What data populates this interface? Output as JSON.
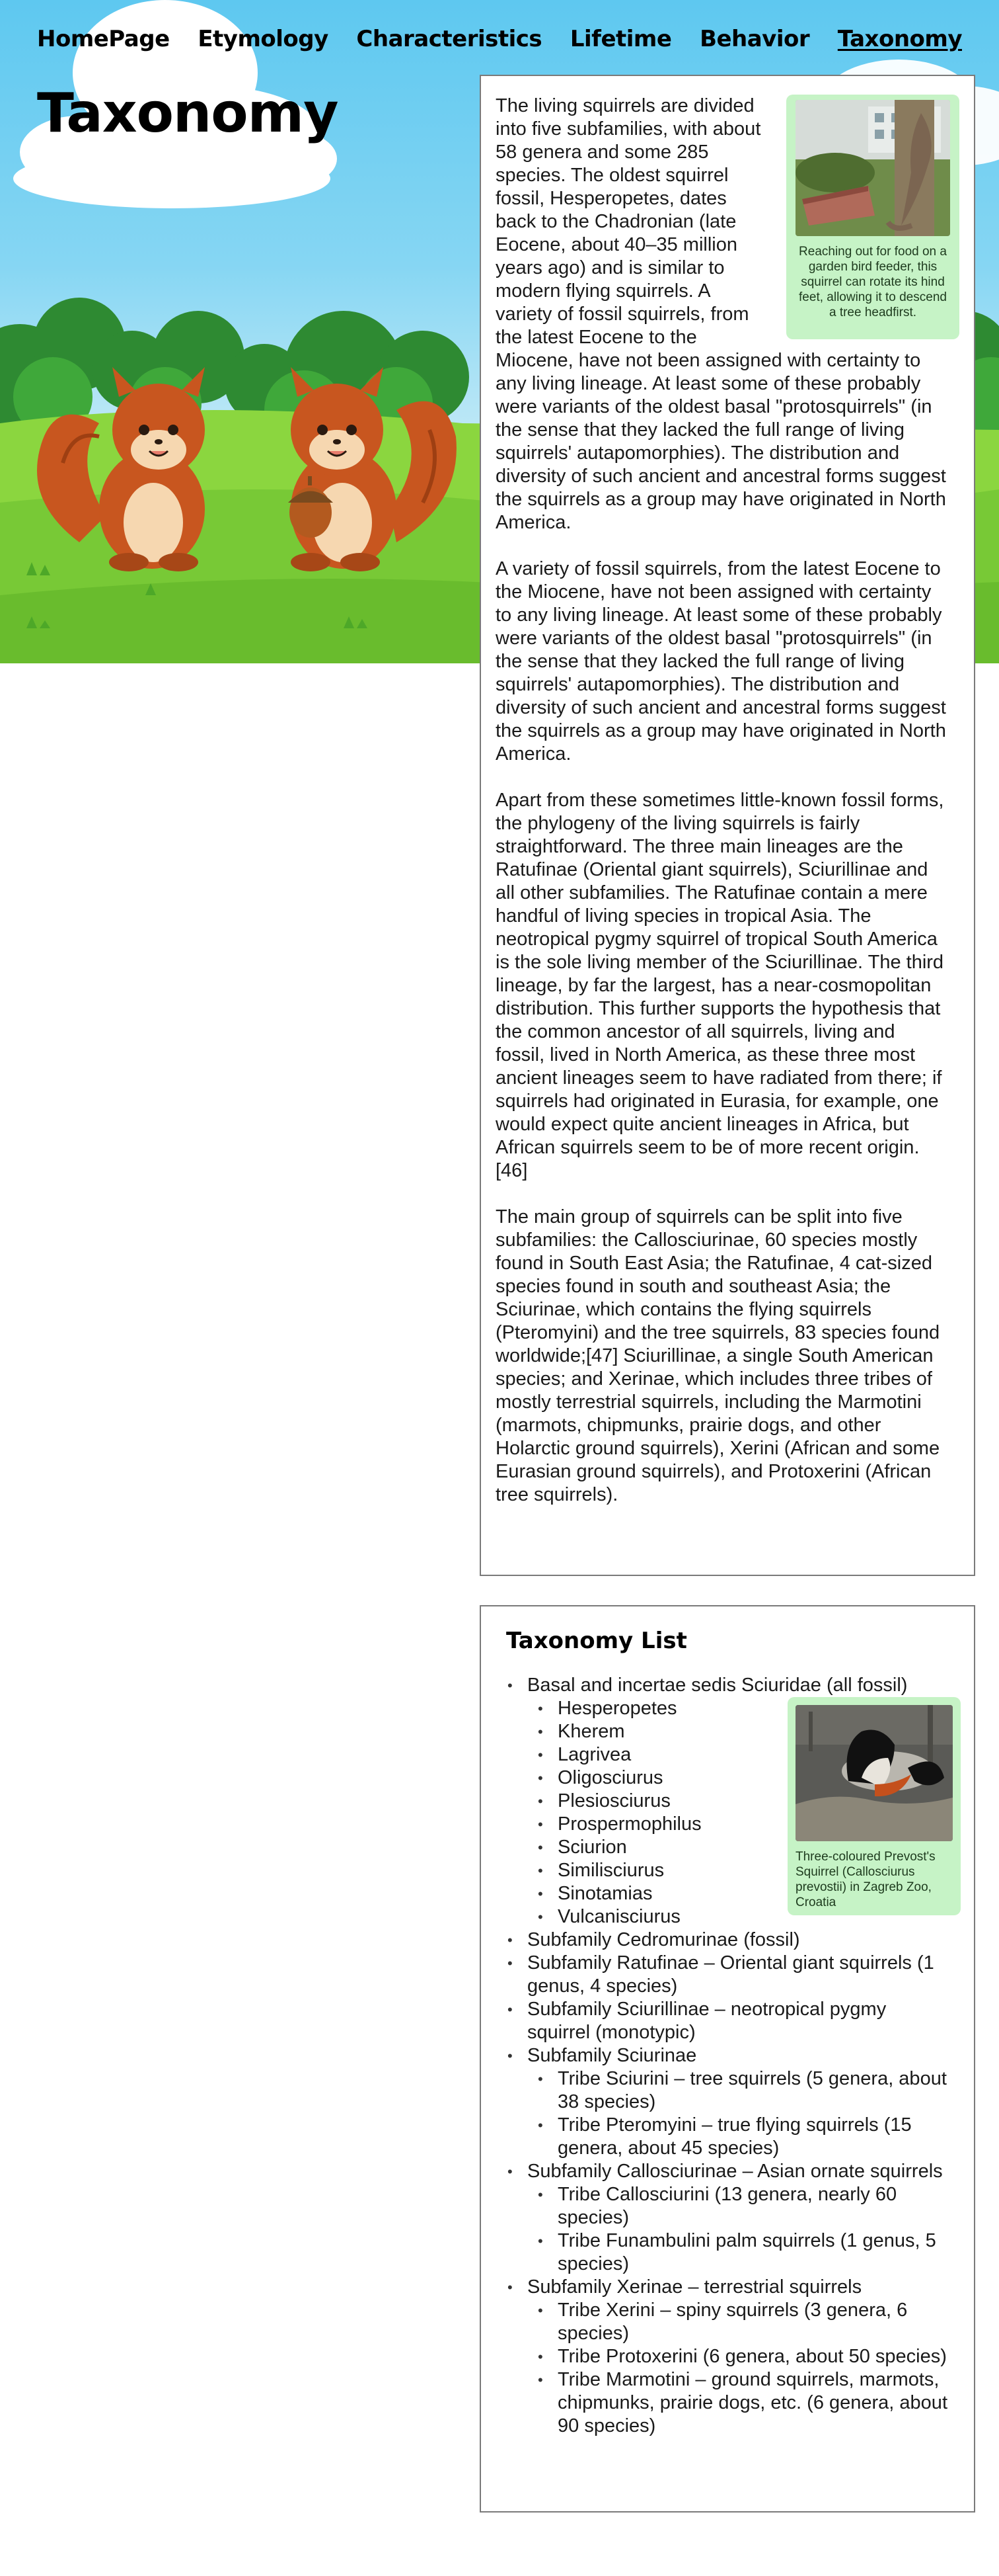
{
  "nav": {
    "items": [
      {
        "label": "HomePage",
        "active": false
      },
      {
        "label": "Etymology",
        "active": false
      },
      {
        "label": "Characteristics",
        "active": false
      },
      {
        "label": "Lifetime",
        "active": false
      },
      {
        "label": "Behavior",
        "active": false
      },
      {
        "label": "Taxonomy",
        "active": true
      }
    ]
  },
  "page": {
    "title": "Taxonomy"
  },
  "article": {
    "figure": {
      "caption": "Reaching out for food on a garden bird feeder, this squirrel can rotate its hind feet, allowing it to descend a tree headfirst.",
      "icon": "squirrel-photo"
    },
    "paragraphs": [
      "The living squirrels are divided into five subfamilies, with about 58 genera and some 285 species. The oldest squirrel fossil, Hesperopetes, dates back to the Chadronian (late Eocene, about 40–35 million years ago) and is similar to modern flying squirrels. A variety of fossil squirrels, from the latest Eocene to the Miocene, have not been assigned with certainty to any living lineage. At least some of these probably were variants of the oldest basal \"protosquirrels\" (in the sense that they lacked the full range of living squirrels' autapomorphies). The distribution and diversity of such ancient and ancestral forms suggest the squirrels as a group may have originated in North America.",
      "A variety of fossil squirrels, from the latest Eocene to the Miocene, have not been assigned with certainty to any living lineage. At least some of these probably were variants of the oldest basal \"protosquirrels\" (in the sense that they lacked the full range of living squirrels' autapomorphies). The distribution and diversity of such ancient and ancestral forms suggest the squirrels as a group may have originated in North America.",
      "Apart from these sometimes little-known fossil forms, the phylogeny of the living squirrels is fairly straightforward. The three main lineages are the Ratufinae (Oriental giant squirrels), Sciurillinae and all other subfamilies. The Ratufinae contain a mere handful of living species in tropical Asia. The neotropical pygmy squirrel of tropical South America is the sole living member of the Sciurillinae. The third lineage, by far the largest, has a near-cosmopolitan distribution. This further supports the hypothesis that the common ancestor of all squirrels, living and fossil, lived in North America, as these three most ancient lineages seem to have radiated from there; if squirrels had originated in Eurasia, for example, one would expect quite ancient lineages in Africa, but African squirrels seem to be of more recent origin.[46]",
      "The main group of squirrels can be split into five subfamilies: the Callosciurinae, 60 species mostly found in South East Asia; the Ratufinae, 4 cat-sized species found in south and southeast Asia; the Sciurinae, which contains the flying squirrels (Pteromyini) and the tree squirrels, 83 species found worldwide;[47] Sciurillinae, a single South American species; and Xerinae, which includes three tribes of mostly terrestrial squirrels, including the Marmotini (marmots, chipmunks, prairie dogs, and other Holarctic ground squirrels), Xerini (African and some Eurasian ground squirrels), and Protoxerini (African tree squirrels)."
    ]
  },
  "taxonomy_list": {
    "heading": "Taxonomy List",
    "figure": {
      "caption": "Three-coloured Prevost's Squirrel (Callosciurus prevostii) in Zagreb Zoo, Croatia",
      "icon": "prevost-squirrel-photo"
    },
    "items": [
      {
        "label": "Basal and incertae sedis Sciuridae (all fossil)",
        "children": [
          "Hesperopetes",
          "Kherem",
          "Lagrivea",
          "Oligosciurus",
          "Plesiosciurus",
          "Prospermophilus",
          "Sciurion",
          "Similisciurus",
          "Sinotamias",
          "Vulcanisciurus"
        ]
      },
      {
        "label": "Subfamily Cedromurinae (fossil)",
        "children": []
      },
      {
        "label": "Subfamily Ratufinae – Oriental giant squirrels (1 genus, 4 species)",
        "children": []
      },
      {
        "label": "Subfamily Sciurillinae – neotropical pygmy squirrel (monotypic)",
        "children": []
      },
      {
        "label": "Subfamily Sciurinae",
        "children": [
          "Tribe Sciurini – tree squirrels (5 genera, about 38 species)",
          "Tribe Pteromyini – true flying squirrels (15 genera, about 45 species)"
        ]
      },
      {
        "label": "Subfamily Callosciurinae – Asian ornate squirrels",
        "children": [
          "Tribe Callosciurini (13 genera, nearly 60 species)",
          "Tribe Funambulini palm squirrels (1 genus, 5 species)"
        ]
      },
      {
        "label": "Subfamily Xerinae – terrestrial squirrels",
        "children": [
          "Tribe Xerini – spiny squirrels (3 genera, 6 species)",
          "Tribe Protoxerini (6 genera, about 50 species)",
          "Tribe Marmotini – ground squirrels, marmots, chipmunks, prairie dogs, etc. (6 genera, about 90 species)"
        ]
      }
    ]
  },
  "theme": {
    "sky": "#6fcdf1",
    "grass": "#7ccf3c",
    "figure_bg": "#c6f3c6",
    "squirrel": "#c8561f"
  }
}
